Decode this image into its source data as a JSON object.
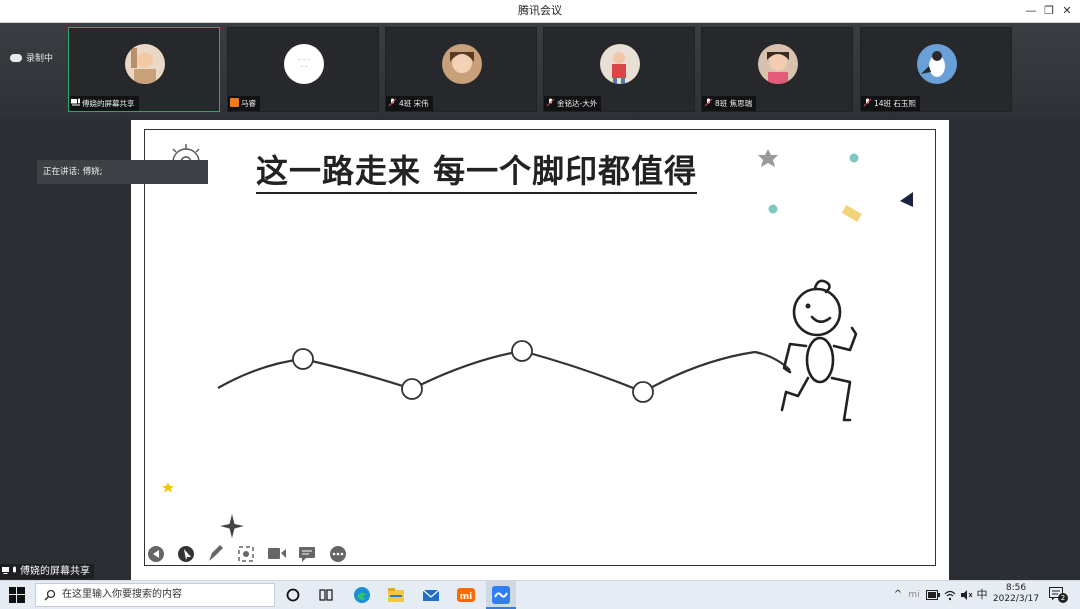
{
  "window": {
    "title": "腾讯会议"
  },
  "recording": {
    "label": "录制中"
  },
  "participants": [
    {
      "name": "傅娆的屏幕共享",
      "icon": "screen-share-mic-icon",
      "active": true
    },
    {
      "name": "马睿",
      "icon": "user-avatar-icon",
      "active": false
    },
    {
      "name": "4班 宋伟",
      "icon": "mic-muted-icon",
      "active": false
    },
    {
      "name": "金铭达-大外",
      "icon": "mic-muted-icon",
      "active": false
    },
    {
      "name": "8班 焦思瑞",
      "icon": "mic-muted-icon",
      "active": false
    },
    {
      "name": "14班 石玉熙",
      "icon": "mic-muted-icon",
      "active": false
    }
  ],
  "speaker": {
    "label": "正在讲话: 傅娆;"
  },
  "slide": {
    "title": "这一路走来   每一个脚印都值得"
  },
  "share_label": "傅娆的屏幕共享",
  "taskbar": {
    "search_placeholder": "在这里输入你要搜索的内容",
    "ime": "中",
    "time": "8:56",
    "date": "2022/3/17",
    "notifications": "2"
  },
  "colors": {
    "active_tile_border": "#2ea56a",
    "teal_dot": "#7ec8c0",
    "yellow_accent": "#f2d37a",
    "navy_triangle": "#1b2340"
  }
}
